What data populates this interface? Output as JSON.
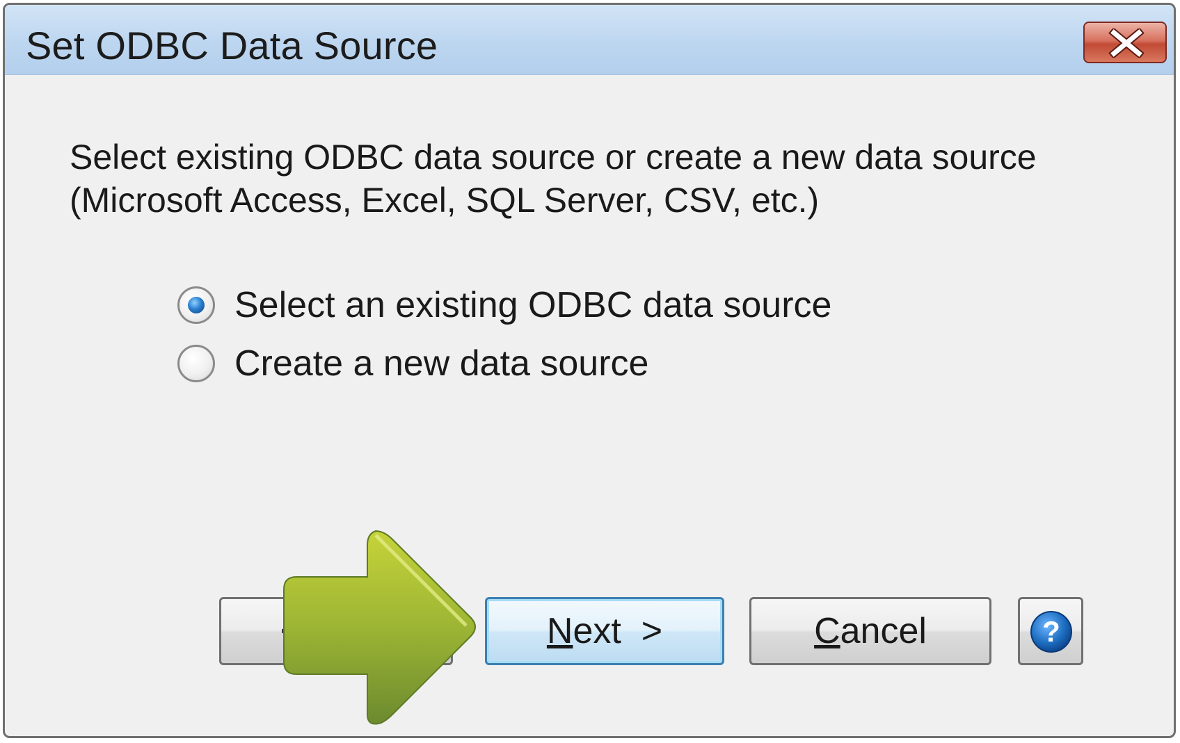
{
  "window": {
    "title": "Set ODBC Data Source"
  },
  "description": {
    "line1": "Select existing ODBC data source or create a new data source",
    "line2": "(Microsoft Access, Excel, SQL Server, CSV, etc.)"
  },
  "options": [
    {
      "label": "Select an existing ODBC data source",
      "checked": true
    },
    {
      "label": "Create a new data source",
      "checked": false
    }
  ],
  "buttons": {
    "back_label": "< Back",
    "next_mnemonic": "N",
    "next_rest": "ext  >",
    "cancel_mnemonic": "C",
    "cancel_rest": "ancel",
    "help_icon": "help-question-icon"
  },
  "colors": {
    "titlebar": "#bdd6f0",
    "close_button": "#c14a34",
    "default_button_border": "#3c7fb1",
    "help_icon": "#1e6fc2",
    "arrow": "#9cb534"
  }
}
